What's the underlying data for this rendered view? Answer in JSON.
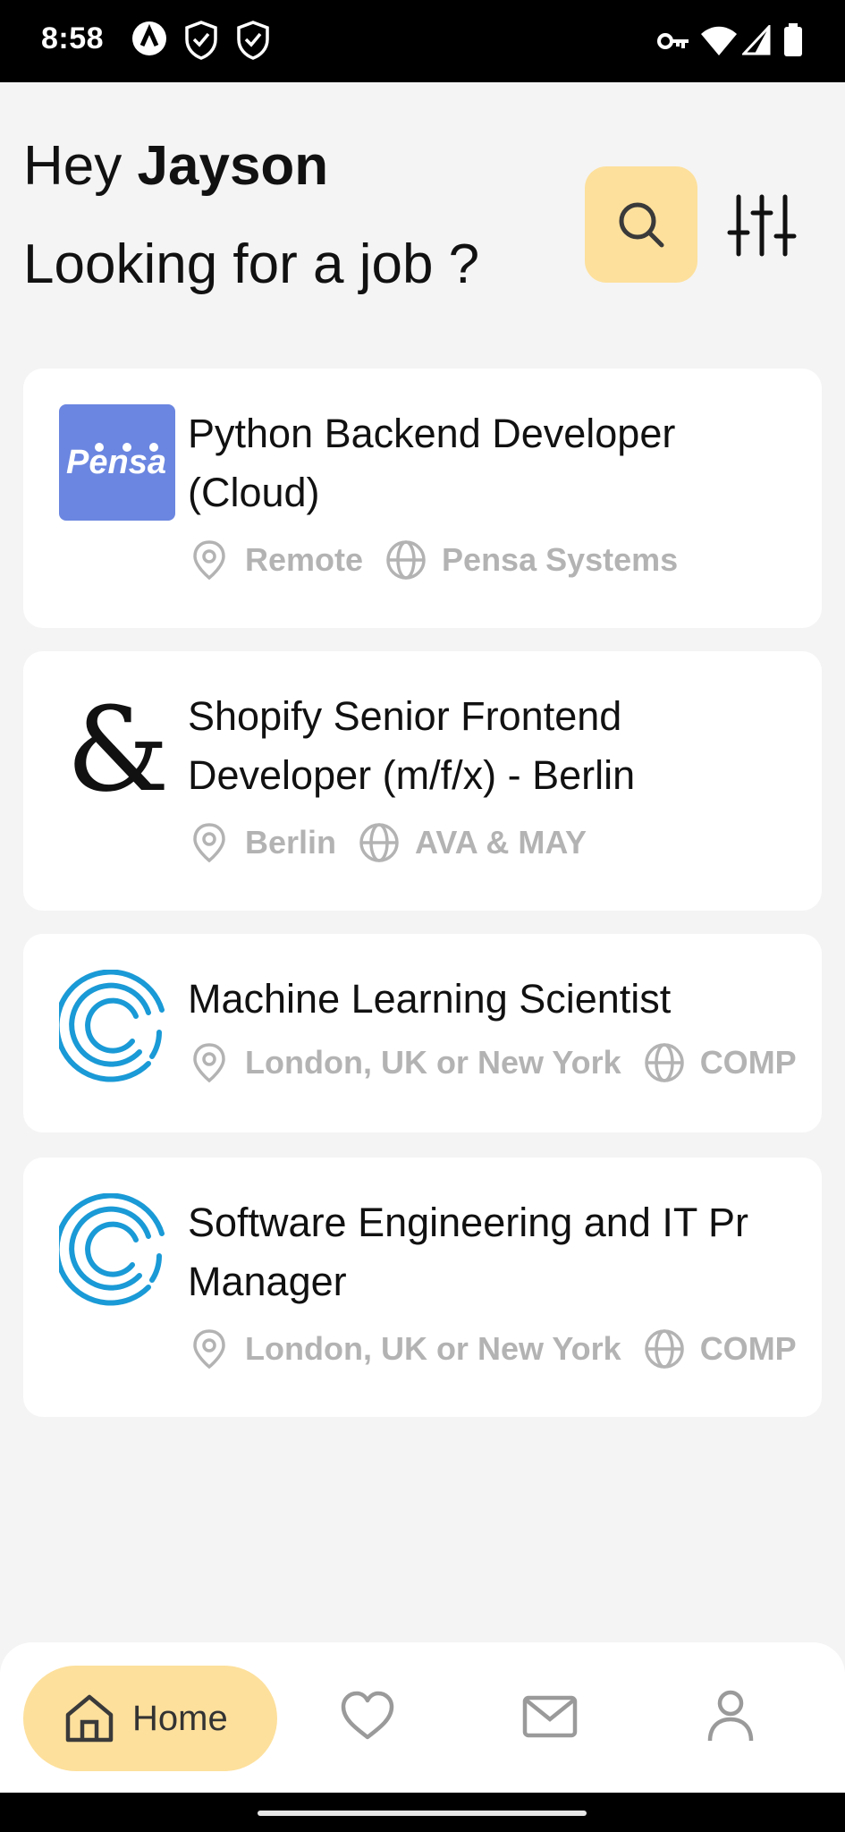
{
  "status_bar": {
    "time": "8:58",
    "icons": [
      "app-a-icon",
      "shield-check-icon",
      "shield-icon",
      "vpn-key-icon",
      "wifi-icon",
      "signal-icon",
      "battery-icon"
    ]
  },
  "header": {
    "greeting_prefix": "Hey",
    "user_name": "Jayson",
    "subtitle": "Looking for a job ?",
    "search_icon": "search-icon",
    "filter_icon": "sliders-icon"
  },
  "colors": {
    "accent": "#fde09c",
    "background": "#f4f4f4",
    "meta_text": "#b3b3b3",
    "pensa_blue": "#6b86e0",
    "ring_blue": "#1a9ad6"
  },
  "jobs": [
    {
      "title_line1": "Python Backend Developer",
      "title_line2": "(Cloud)",
      "location": "Remote",
      "company": "Pensa Systems",
      "logo": "Pensa",
      "location_icon": "location-pin-icon",
      "company_icon": "globe-icon"
    },
    {
      "title_line1": "Shopify Senior Frontend",
      "title_line2": "Developer (m/f/x) - Berlin",
      "location": "Berlin",
      "company": "AVA & MAY",
      "logo": "&",
      "location_icon": "location-pin-icon",
      "company_icon": "globe-icon"
    },
    {
      "title_line1": "Machine Learning Scientist",
      "location": "London, UK or New York",
      "company": "COMP",
      "logo": "concentric-rings-logo",
      "location_icon": "location-pin-icon",
      "company_icon": "globe-icon"
    },
    {
      "title_line1": "Software Engineering and IT Pr",
      "title_line2": "Manager",
      "location": "London, UK or New York",
      "company": "COMP",
      "logo": "concentric-rings-logo",
      "location_icon": "location-pin-icon",
      "company_icon": "globe-icon"
    }
  ],
  "bottom_nav": {
    "home_label": "Home",
    "items": [
      "home-icon",
      "heart-icon",
      "mail-icon",
      "user-icon"
    ]
  }
}
